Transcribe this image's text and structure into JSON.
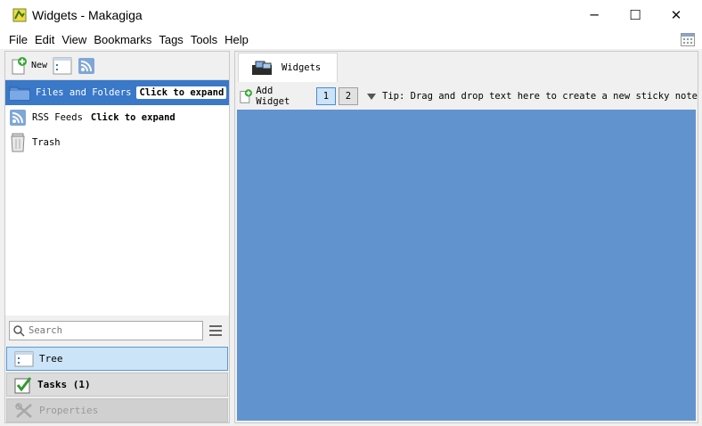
{
  "window": {
    "title": "Widgets - Makagiga",
    "controls": {
      "minimize": "─",
      "maximize": "☐",
      "close": "✕"
    }
  },
  "menu": [
    "File",
    "Edit",
    "View",
    "Bookmarks",
    "Tags",
    "Tools",
    "Help"
  ],
  "toolbar": {
    "new_label": "New"
  },
  "tree": {
    "items": [
      {
        "label": "Files and Folders",
        "hint": "Click to expand",
        "icon": "folder-icon",
        "selected": true
      },
      {
        "label": "RSS Feeds",
        "hint": "Click to expand",
        "icon": "rss-icon",
        "selected": false
      },
      {
        "label": "Trash",
        "hint": "",
        "icon": "trash-icon",
        "selected": false
      }
    ]
  },
  "search": {
    "placeholder": "Search"
  },
  "nav": {
    "tree": "Tree",
    "tasks": "Tasks (1)",
    "properties": "Properties"
  },
  "tabs": {
    "widgets": "Widgets"
  },
  "widget_toolbar": {
    "add_widget": "Add Widget",
    "pages": [
      "1",
      "2"
    ],
    "active_page": "1",
    "tip": "Tip: Drag and drop text here to create a new sticky note"
  },
  "colors": {
    "canvas": "#6193cf",
    "selection": "#3a78c8"
  }
}
